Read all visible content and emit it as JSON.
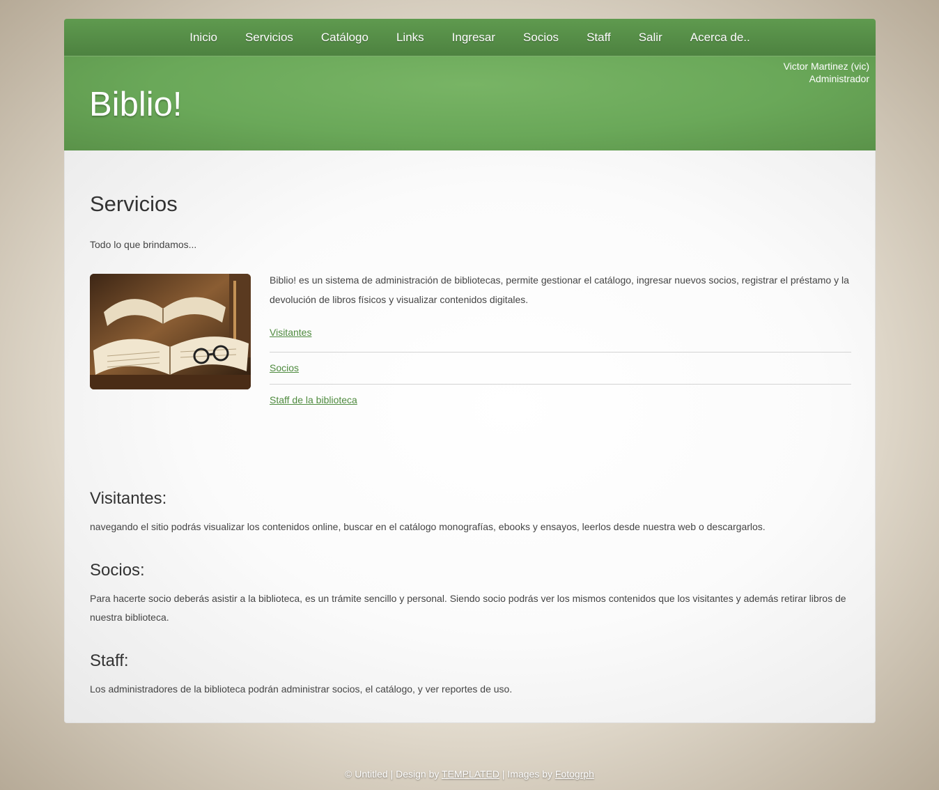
{
  "nav": {
    "items": [
      "Inicio",
      "Servicios",
      "Catálogo",
      "Links",
      "Ingresar",
      "Socios",
      "Staff",
      "Salir",
      "Acerca de.."
    ]
  },
  "header": {
    "title": "Biblio!",
    "user_name": "Victor Martinez (vic)",
    "user_role": "Administrador"
  },
  "main": {
    "title": "Servicios",
    "intro": "Todo lo que brindamos...",
    "description": "Biblio! es un sistema de administración de bibliotecas, permite gestionar el catálogo, ingresar nuevos socios, registrar el préstamo y la devolución de libros físicos y visualizar contenidos digitales.",
    "links": [
      "Visitantes",
      "Socios",
      "Staff de la biblioteca"
    ],
    "sections": [
      {
        "heading": "Visitantes:",
        "text": "navegando el sitio podrás visualizar los contenidos online, buscar en el catálogo monografías, ebooks y ensayos, leerlos desde nuestra web o descargarlos."
      },
      {
        "heading": "Socios:",
        "text": "Para hacerte socio deberás asistir a la biblioteca, es un trámite sencillo y personal. Siendo socio podrás ver los mismos contenidos que los visitantes y además retirar libros de nuestra biblioteca."
      },
      {
        "heading": "Staff:",
        "text": "Los administradores de la biblioteca podrán administrar socios, el catálogo, y ver reportes de uso."
      }
    ]
  },
  "footer": {
    "prefix": "© Untitled | Design by ",
    "templated": "TEMPLATED",
    "middle": " | Images by ",
    "fotogrph": "Fotogrph"
  },
  "colors": {
    "nav_green": "#5f9a4f",
    "header_green": "#6aa859",
    "link_green": "#4e8a3e"
  }
}
